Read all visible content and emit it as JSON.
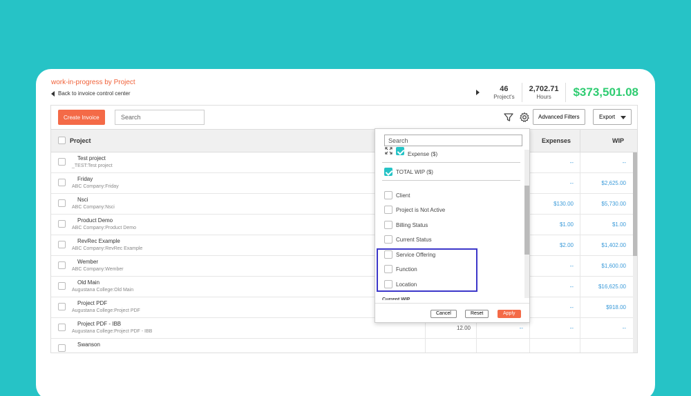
{
  "header": {
    "title": "work-in-progress by Project",
    "back_link": "Back to invoice control center"
  },
  "stats": {
    "projects_value": "46",
    "projects_label": "Project's",
    "hours_value": "2,702.71",
    "hours_label": "Hours",
    "total_wip": "$373,501.08"
  },
  "toolbar": {
    "create_label": "Create Invoice",
    "search_placeholder": "Search",
    "advanced_filters_label": "Advanced Filters",
    "export_label": "Export",
    "icons": [
      "filter-icon",
      "gear-icon"
    ]
  },
  "table": {
    "columns": {
      "project": "Project",
      "expenses": "Expenses",
      "wip": "WIP"
    },
    "rows": [
      {
        "name": "Test project",
        "sub": "_TEST:Test project",
        "hours": "",
        "amount": "",
        "expenses": "--",
        "wip": "--"
      },
      {
        "name": "Friday",
        "sub": "ABC Company:Friday",
        "hours": "",
        "amount": "",
        "expenses": "--",
        "wip": "$2,625.00"
      },
      {
        "name": "Nsci",
        "sub": "ABC Company:Nsci",
        "hours": "",
        "amount": "",
        "expenses": "$130.00",
        "wip": "$5,730.00"
      },
      {
        "name": "Product Demo",
        "sub": "ABC Company:Product Demo",
        "hours": "",
        "amount": "",
        "expenses": "$1.00",
        "wip": "$1.00"
      },
      {
        "name": "RevRec Example",
        "sub": "ABC Company:RevRec Example",
        "hours": "",
        "amount": "",
        "expenses": "$2.00",
        "wip": "$1,402.00"
      },
      {
        "name": "Wember",
        "sub": "ABC Company:Wember",
        "hours": "",
        "amount": "",
        "expenses": "--",
        "wip": "$1,600.00"
      },
      {
        "name": "Old Main",
        "sub": "Augustana College:Old Main",
        "hours": "",
        "amount": "",
        "expenses": "--",
        "wip": "$16,625.00"
      },
      {
        "name": "Project PDF",
        "sub": "Augustana College:Project PDF",
        "hours": "",
        "amount": "",
        "expenses": "--",
        "wip": "$918.00"
      },
      {
        "name": "Project PDF - IBB",
        "sub": "Augustana College:Project PDF - IBB",
        "hours": "12.00",
        "amount": "--",
        "expenses": "--",
        "wip": "--"
      },
      {
        "name": "Swanson",
        "sub": "",
        "hours": "",
        "amount": "",
        "expenses": "",
        "wip": ""
      }
    ]
  },
  "column_picker": {
    "search_placeholder": "Search",
    "checked": [
      {
        "label": "Expense ($)",
        "checked": true
      },
      {
        "label": "TOTAL WIP ($)",
        "checked": true
      }
    ],
    "options": [
      {
        "label": "Client",
        "checked": false
      },
      {
        "label": "Project is Not Active",
        "checked": false
      },
      {
        "label": "Billing Status",
        "checked": false
      },
      {
        "label": "Current Status",
        "checked": false
      },
      {
        "label": "Service Offering",
        "checked": false
      },
      {
        "label": "Function",
        "checked": false
      },
      {
        "label": "Location",
        "checked": false
      }
    ],
    "next_section": "Current WIP",
    "cancel_label": "Cancel",
    "reset_label": "Reset",
    "apply_label": "Apply"
  },
  "colors": {
    "background": "#26c3c6",
    "accent_orange": "#f46a47",
    "money_green": "#2ecc71",
    "link_blue": "#3a9ad9",
    "highlight_box": "#3b36c9"
  }
}
